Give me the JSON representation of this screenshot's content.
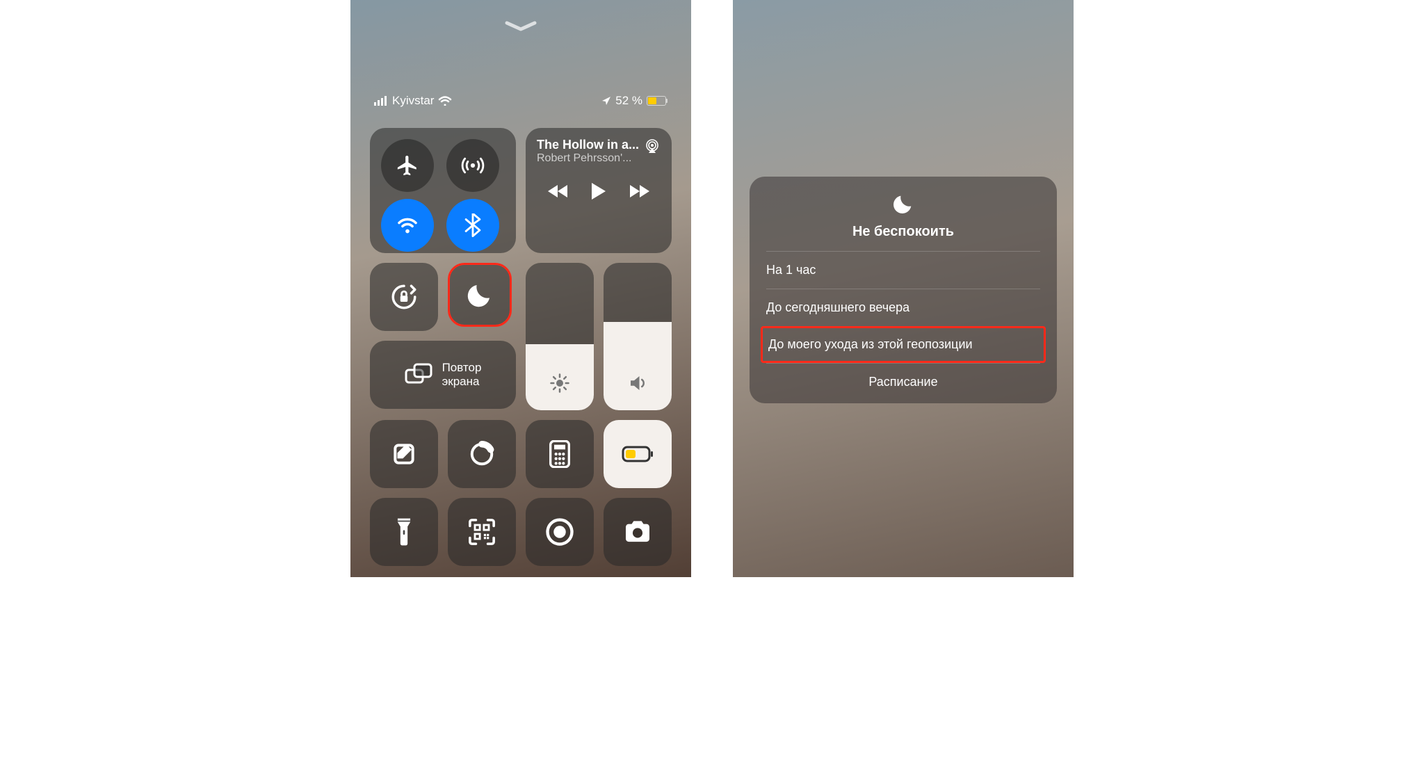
{
  "status": {
    "carrier": "Kyivstar",
    "battery_text": "52 %"
  },
  "media": {
    "title": "The Hollow in a...",
    "artist": "Robert Pehrsson'..."
  },
  "screen_mirror": {
    "line1": "Повтор",
    "line2": "экрана"
  },
  "dnd": {
    "title": "Не беспокоить",
    "options": [
      "На 1 час",
      "До сегодняшнего вечера",
      "До моего ухода из этой геопозиции"
    ],
    "footer": "Расписание"
  },
  "colors": {
    "highlight": "#ff2a1a",
    "blue": "#0a7dff",
    "battery": "#ffcc00"
  }
}
